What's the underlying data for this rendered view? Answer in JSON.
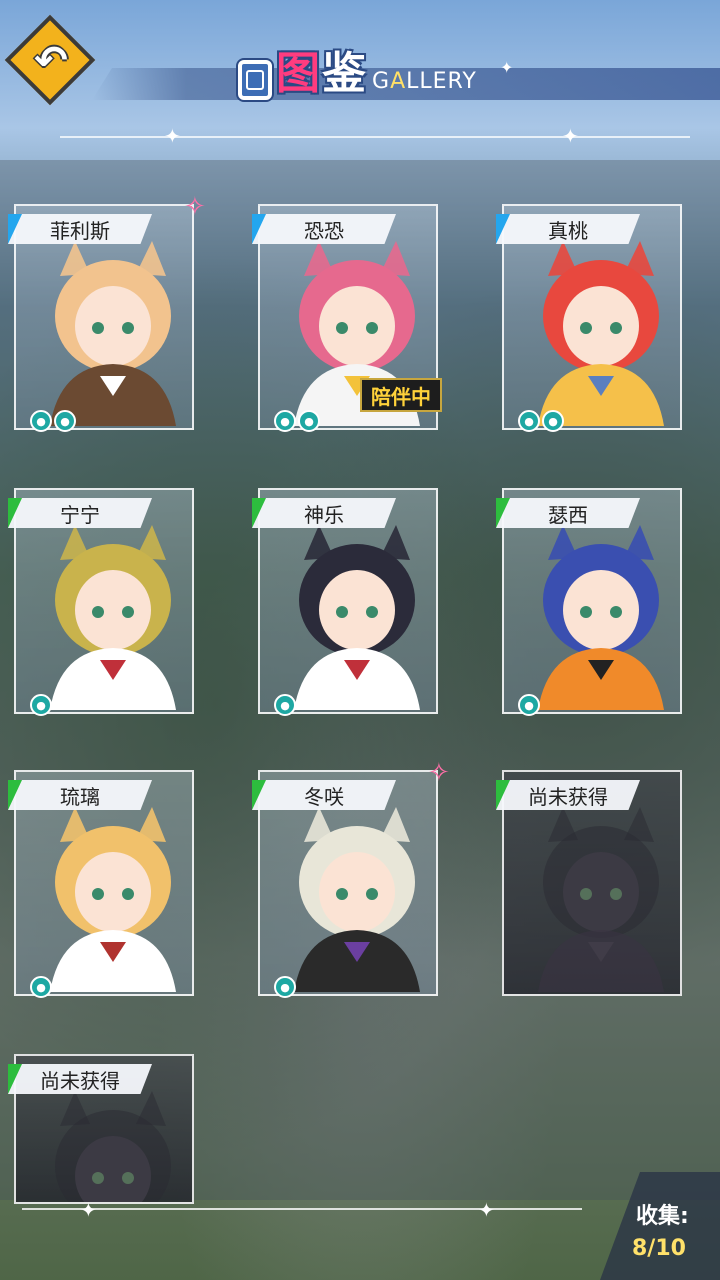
{
  "header": {
    "title_icon": "gallery-book-icon",
    "title_cn_1": "图",
    "title_cn_2": "鉴",
    "title_en_1": "G",
    "title_en_2": "A",
    "title_en_3": "LLERY",
    "back_icon": "back-arrow-icon"
  },
  "cards": [
    {
      "name": "菲利斯",
      "paws": 2,
      "tag_color": "#24a6ee",
      "favorite": true
    },
    {
      "name": "恐恐",
      "paws": 2,
      "tag_color": "#24a6ee",
      "badge": "陪伴中"
    },
    {
      "name": "真桃",
      "paws": 2,
      "tag_color": "#24a6ee"
    },
    {
      "name": "宁宁",
      "paws": 1,
      "tag_color": "#2dbd3e"
    },
    {
      "name": "神乐",
      "paws": 1,
      "tag_color": "#2dbd3e"
    },
    {
      "name": "瑟西",
      "paws": 1,
      "tag_color": "#2dbd3e"
    },
    {
      "name": "琉璃",
      "paws": 1,
      "tag_color": "#2dbd3e"
    },
    {
      "name": "冬咲",
      "paws": 1,
      "tag_color": "#2dbd3e",
      "favorite": true
    },
    {
      "name": "尚未获得",
      "paws": 0,
      "tag_color": "#2dbd3e",
      "locked": true
    },
    {
      "name": "尚未获得",
      "paws": 0,
      "tag_color": "#2dbd3e",
      "locked": true
    }
  ],
  "footer": {
    "collect_label": "收集:",
    "collect_value": "8/10"
  }
}
